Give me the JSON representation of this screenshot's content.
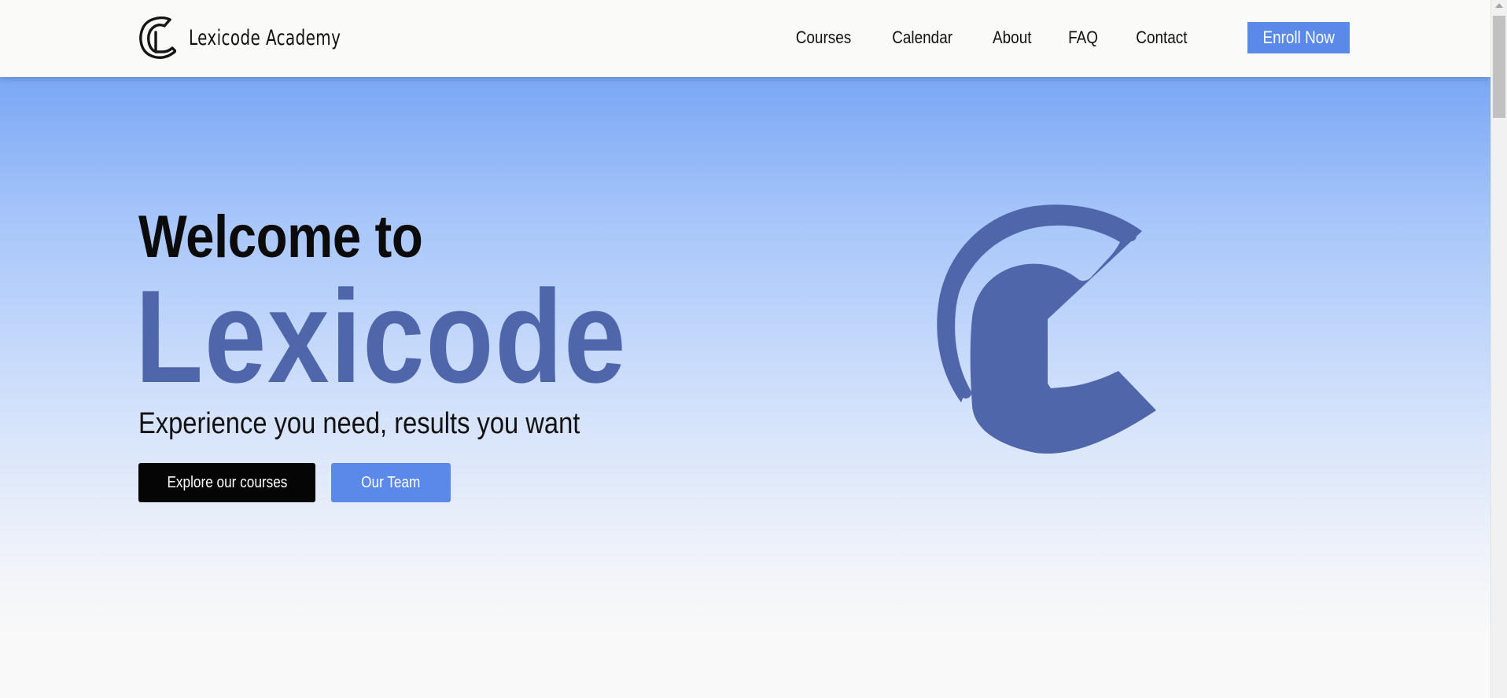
{
  "header": {
    "brand_name": "Lexicode Academy",
    "logo_icon": "lexicode-cl-logo-icon",
    "nav": [
      {
        "label": "Courses"
      },
      {
        "label": "Calendar"
      },
      {
        "label": "About"
      },
      {
        "label": "FAQ"
      },
      {
        "label": "Contact"
      }
    ],
    "enroll_label": "Enroll Now"
  },
  "hero": {
    "welcome": "Welcome to",
    "title": "Lexicode",
    "tagline": "Experience you need, results you want",
    "explore_label": "Explore our courses",
    "team_label": "Our Team",
    "logo_icon": "lexicode-cl-logo-icon"
  },
  "colors": {
    "accent": "#5a89ea",
    "brand_blue": "#4f66ab",
    "hero_top": "#7aa7f5",
    "dark_button": "#050505"
  }
}
